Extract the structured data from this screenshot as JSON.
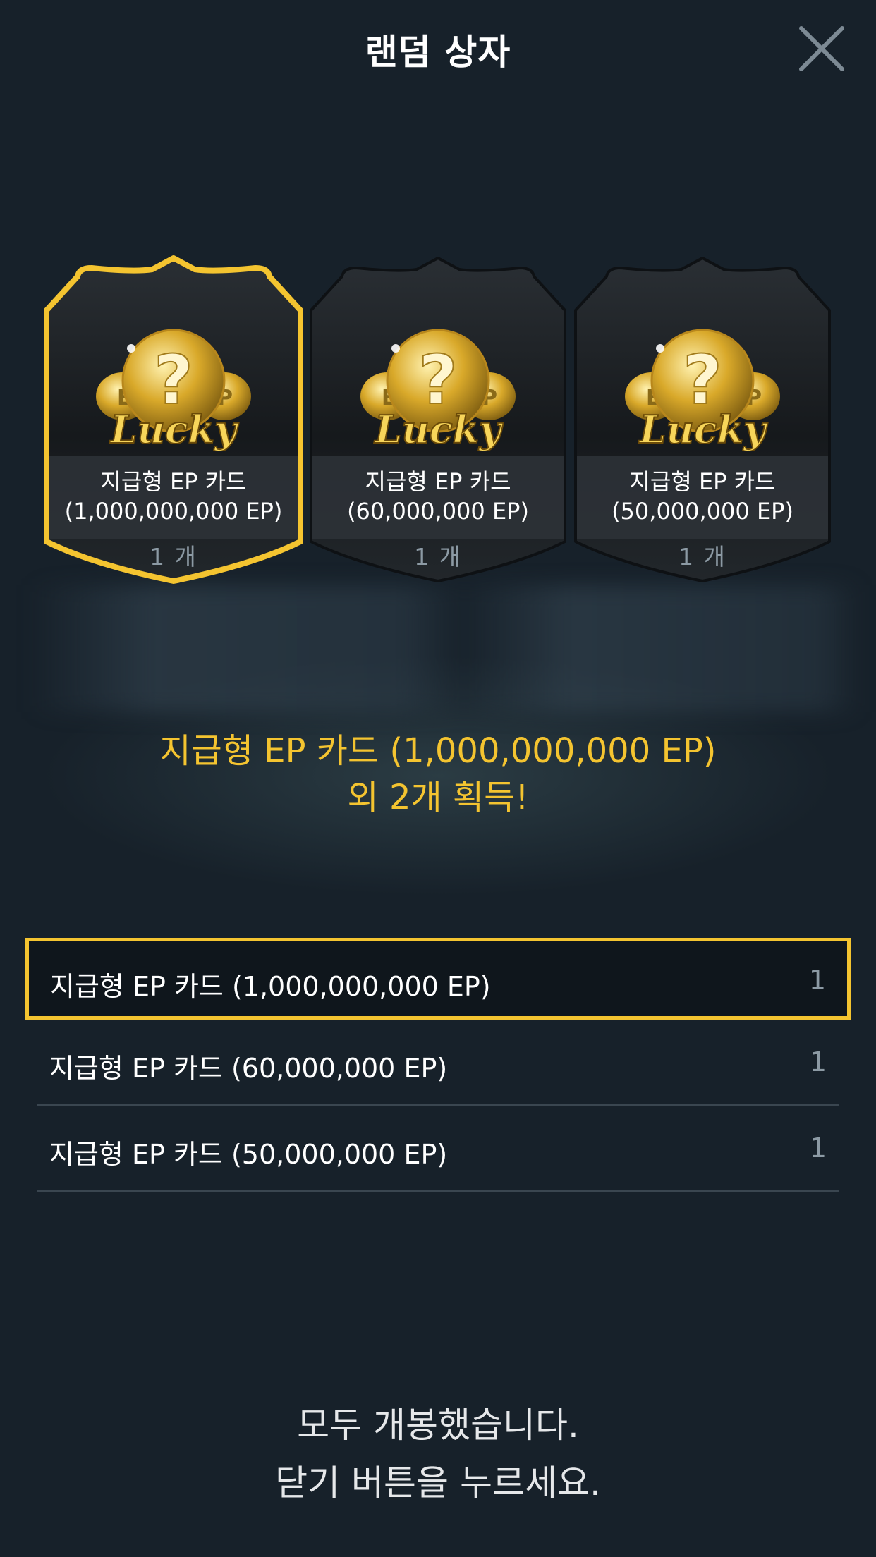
{
  "header": {
    "title": "랜덤 상자",
    "close_icon": "close-icon"
  },
  "cards": [
    {
      "name_line1": "지급형 EP 카드",
      "name_line2": "(1,000,000,000 EP)",
      "count": "1 개",
      "selected": true,
      "icon": "lucky-coin-icon",
      "coin_text": "Lucky"
    },
    {
      "name_line1": "지급형 EP 카드",
      "name_line2": "(60,000,000 EP)",
      "count": "1 개",
      "selected": false,
      "icon": "lucky-coin-icon",
      "coin_text": "Lucky"
    },
    {
      "name_line1": "지급형 EP 카드",
      "name_line2": "(50,000,000 EP)",
      "count": "1 개",
      "selected": false,
      "icon": "lucky-coin-icon",
      "coin_text": "Lucky"
    }
  ],
  "result": {
    "line1": "지급형 EP 카드 (1,000,000,000 EP)",
    "line2": "외 2개 획득!"
  },
  "items": [
    {
      "label": "지급형 EP 카드 (1,000,000,000 EP)",
      "qty": "1",
      "selected": true
    },
    {
      "label": "지급형 EP 카드 (60,000,000 EP)",
      "qty": "1",
      "selected": false
    },
    {
      "label": "지급형 EP 카드 (50,000,000 EP)",
      "qty": "1",
      "selected": false
    }
  ],
  "footer": {
    "line1": "모두 개봉했습니다.",
    "line2": "닫기 버튼을 누르세요."
  },
  "colors": {
    "accent": "#f4c430",
    "background": "#17212a",
    "muted": "#8c9aa4"
  }
}
